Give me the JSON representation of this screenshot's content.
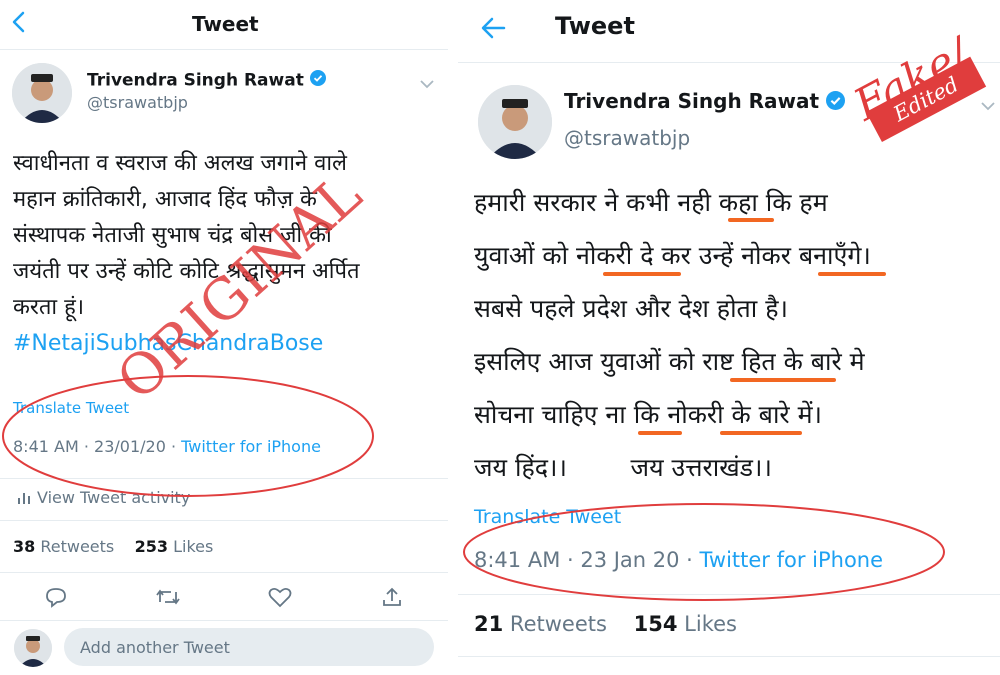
{
  "left": {
    "header_title": "Tweet",
    "user": {
      "name": "Trivendra Singh Rawat",
      "handle": "@tsrawatbjp"
    },
    "text_lines": [
      "स्वाधीनता व स्वराज की अलख जगाने वाले",
      "महान क्रांतिकारी, आजाद हिंद फौज़ के",
      "संस्थापक नेताजी सुभाष चंद्र बोस जी की",
      "जयंती पर उन्हें कोटि कोटि श्रद्धासुमन अर्पित",
      "करता हूं।"
    ],
    "hashtag": "#NetajiSubhasChandraBose",
    "translate": "Translate Tweet",
    "time": "8:41 AM · 23/01/20 · ",
    "source": "Twitter for iPhone",
    "activity": "View Tweet activity",
    "retweets_count": "38",
    "retweets_label": "Retweets",
    "likes_count": "253",
    "likes_label": "Likes",
    "reply_placeholder": "Add another Tweet",
    "stamp": "ORIGINAL"
  },
  "right": {
    "header_title": "Tweet",
    "user": {
      "name": "Trivendra Singh Rawat",
      "handle": "@tsrawatbjp"
    },
    "text_lines": [
      "हमारी सरकार ने कभी नही कहा कि हम",
      "युवाओं को नोकरी दे कर उन्हें नोकर बनाएँगे।",
      "सबसे पहले प्रदेश और देश होता है।",
      "इसलिए आज युवाओं को राष्ट हित के बारे मे",
      "सोचना चाहिए ना कि नोकरी के बारे में।",
      "जय हिंद।।        जय उत्तराखंड।।"
    ],
    "translate": "Translate Tweet",
    "time": "8:41 AM · 23 Jan 20 · ",
    "source": "Twitter for iPhone",
    "retweets_count": "21",
    "retweets_label": "Retweets",
    "likes_count": "154",
    "likes_label": "Likes",
    "fake_label": "Fake/",
    "edited_label": "Edited"
  },
  "colors": {
    "twitter_blue": "#1da1f2",
    "stamp_red": "#e03d3d",
    "underline_orange": "#f26722",
    "muted_gray": "#657786"
  },
  "icons": [
    "back-arrow-icon",
    "verified-badge-icon",
    "chevron-down-icon",
    "bar-chart-icon",
    "reply-icon",
    "retweet-icon",
    "like-icon",
    "share-icon"
  ]
}
